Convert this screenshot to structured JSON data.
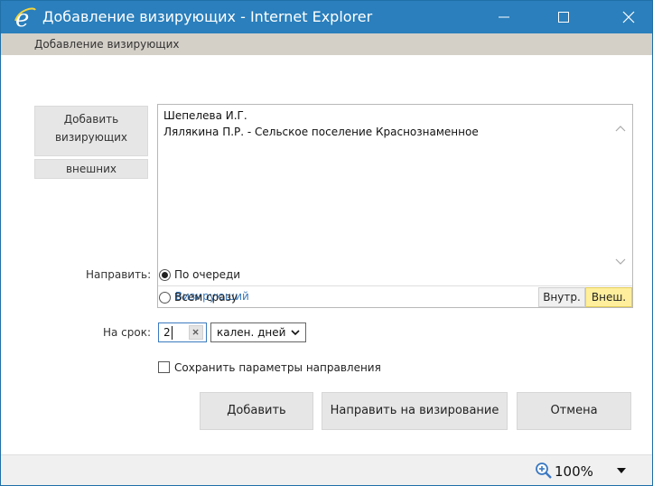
{
  "window": {
    "title": "Добавление визирующих - Internet Explorer",
    "subheader": "Добавление визирующих",
    "colors": {
      "titlebar": "#2a7fbc",
      "accent_link": "#3b7bbf",
      "selected_segment": "#ffef9c"
    }
  },
  "left_buttons": {
    "add_line1": "Добавить",
    "add_line2": "визирующих",
    "external": "внешних"
  },
  "signers": {
    "items": [
      "Шепелева И.Г.",
      "Ляля­кина П.Р. - Сельское поселение Краснознаменное"
    ],
    "add_link": "+ Визирующий",
    "segment_internal": "Внутр.",
    "segment_external": "Внеш.",
    "segment_selected": "Внеш."
  },
  "direction": {
    "label": "Направить:",
    "options": [
      "По очереди",
      "Всем сразу"
    ],
    "selected": "По очереди"
  },
  "term": {
    "label": "На срок:",
    "value": "2",
    "unit": "кален. дней"
  },
  "save_params": {
    "label": "Сохранить параметры направления",
    "checked": false
  },
  "buttons": {
    "add": "Добавить",
    "send": "Направить на визирование",
    "cancel": "Отмена"
  },
  "statusbar": {
    "zoom": "100%"
  },
  "icons": {
    "logo": "internet-explorer-logo",
    "minimize": "minimize-icon",
    "maximize": "maximize-icon",
    "close": "close-icon",
    "scroll_up": "chevron-up-icon",
    "scroll_down": "chevron-down-icon",
    "clear": "clear-x-icon",
    "select": "chevron-down-icon",
    "zoom": "zoom-in-icon",
    "zoom_dropdown": "triangle-down-icon"
  }
}
